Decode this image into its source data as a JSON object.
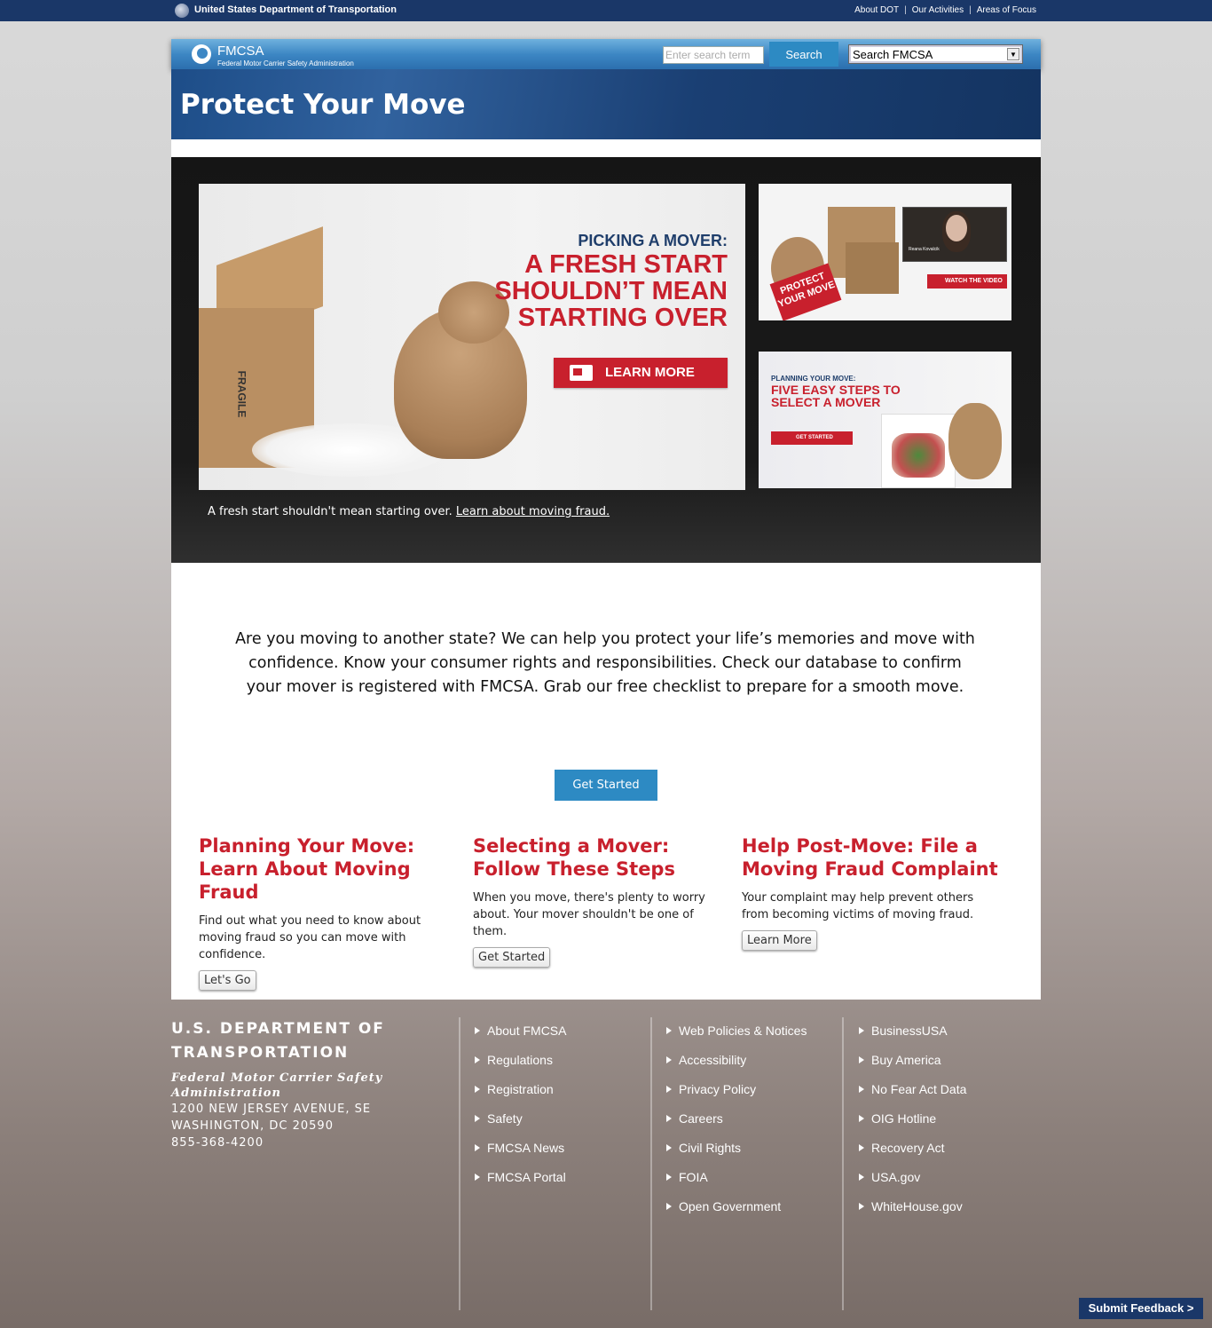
{
  "topbar": {
    "title": "United States Department of Transportation",
    "links": [
      "About DOT",
      "Our Activities",
      "Areas of Focus"
    ]
  },
  "header": {
    "brand": "FMCSA",
    "brand_sub": "Federal Motor Carrier Safety Administration",
    "search_placeholder": "Enter search term",
    "search_button": "Search",
    "search_scope": "Search FMCSA"
  },
  "page_title": "Protect Your Move",
  "hero": {
    "main": {
      "kicker": "PICKING A MOVER:",
      "headline": "A FRESH START SHOULDN’T MEAN STARTING OVER",
      "button": "LEARN MORE",
      "box_label": "FRAGILE"
    },
    "side1": {
      "ribbon": "PROTECT YOUR MOVE",
      "person": "Reana Kovalcik",
      "button": "WATCH THE VIDEO"
    },
    "side2": {
      "kicker": "PLANNING YOUR MOVE:",
      "headline": "FIVE EASY STEPS TO SELECT A MOVER",
      "button": "GET STARTED"
    },
    "caption": "A fresh start shouldn't mean starting over.",
    "caption_link": "Learn about moving fraud."
  },
  "intro": "Are you moving to another state? We can help you protect your life’s memories and move with confidence. Know your consumer rights and responsibilities. Check our database to confirm your mover is registered with FMCSA. Grab our free checklist to prepare for a smooth move.",
  "get_started": "Get Started",
  "columns": [
    {
      "title": "Planning Your Move: Learn About Moving Fraud",
      "text": "Find out what you need to know about moving fraud so you can move with confidence.",
      "button": "Let's Go"
    },
    {
      "title": "Selecting a Mover: Follow These Steps",
      "text": "When you move, there's plenty to worry about. Your mover shouldn't be one of them.",
      "button": "Get Started"
    },
    {
      "title": "Help Post-Move: File a Moving Fraud Complaint",
      "text": "Your complaint may help prevent others from becoming victims of moving fraud.",
      "button": "Learn More"
    }
  ],
  "footer": {
    "dept": "U.S. DEPARTMENT OF TRANSPORTATION",
    "agency": "Federal Motor Carrier Safety Administration",
    "address1": "1200 NEW JERSEY AVENUE, SE",
    "address2": "WASHINGTON, DC 20590",
    "phone": "855-368-4200",
    "list1": [
      "About FMCSA",
      "Regulations",
      "Registration",
      "Safety",
      "FMCSA News",
      "FMCSA Portal"
    ],
    "list2": [
      "Web Policies & Notices",
      "Accessibility",
      "Privacy Policy",
      "Careers",
      "Civil Rights",
      "FOIA",
      "Open Government"
    ],
    "list3": [
      "BusinessUSA",
      "Buy America",
      "No Fear Act Data",
      "OIG Hotline",
      "Recovery Act",
      "USA.gov",
      "WhiteHouse.gov"
    ]
  },
  "feedback": "Submit Feedback >"
}
